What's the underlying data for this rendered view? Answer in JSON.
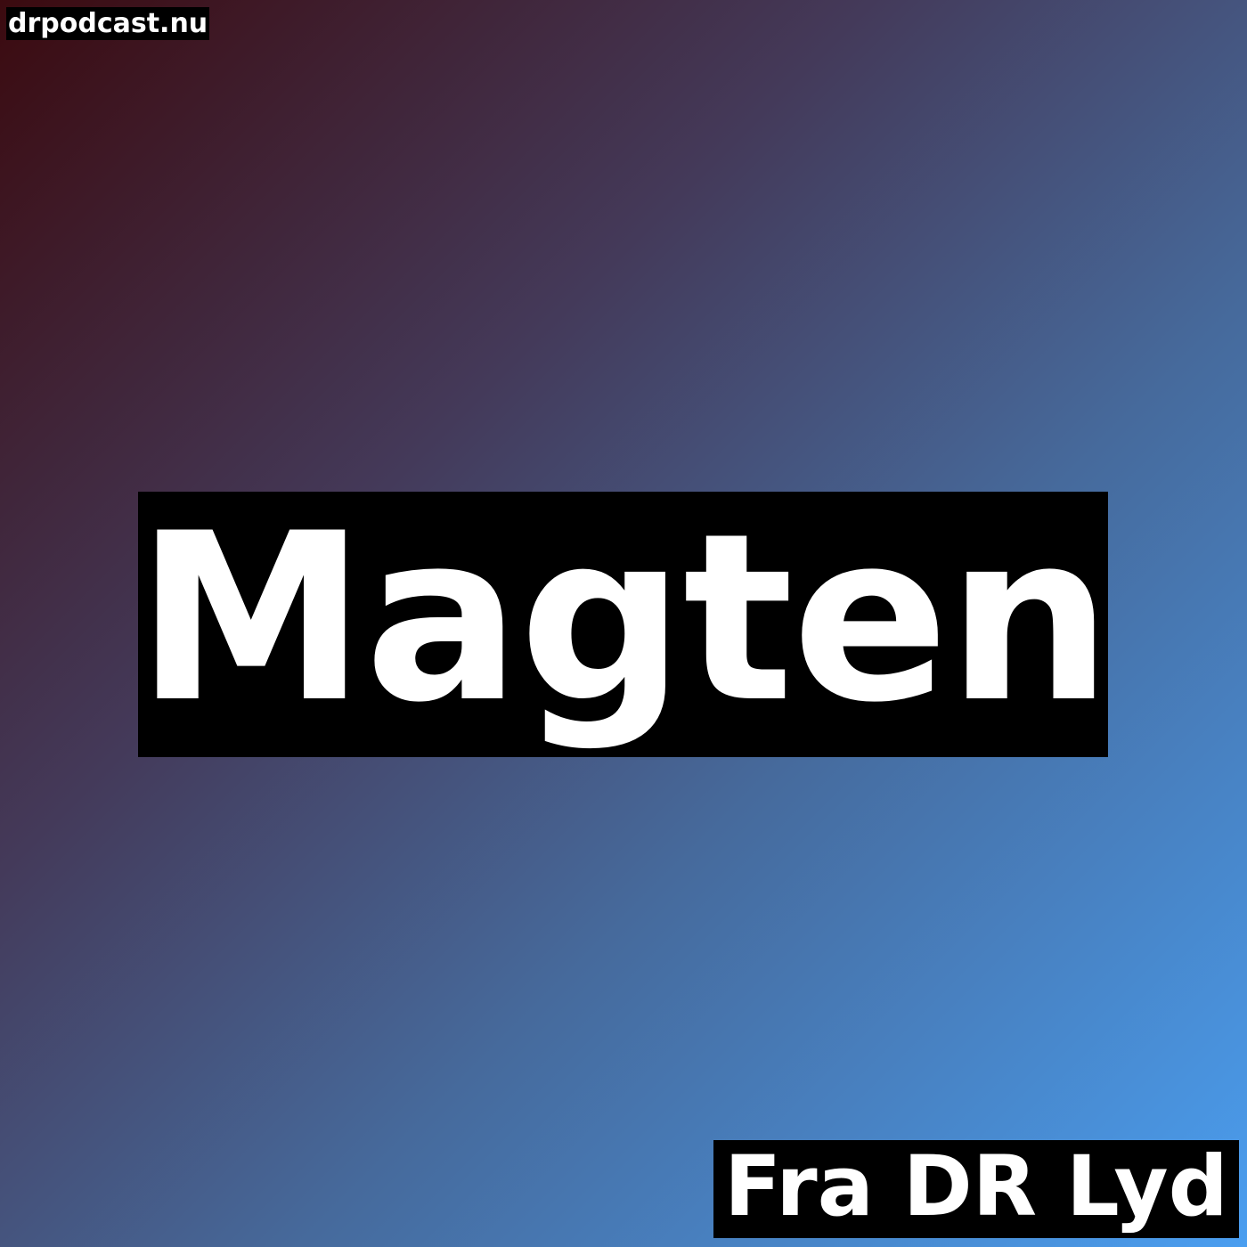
{
  "cover": {
    "site": "drpodcast.nu",
    "title": "Magten",
    "source": "Fra DR Lyd"
  },
  "colors": {
    "gradient_start": "#3b0a0f",
    "gradient_mid": "#466a9c",
    "gradient_end": "#4a9ef0",
    "label_background": "#000000",
    "text": "#ffffff"
  }
}
